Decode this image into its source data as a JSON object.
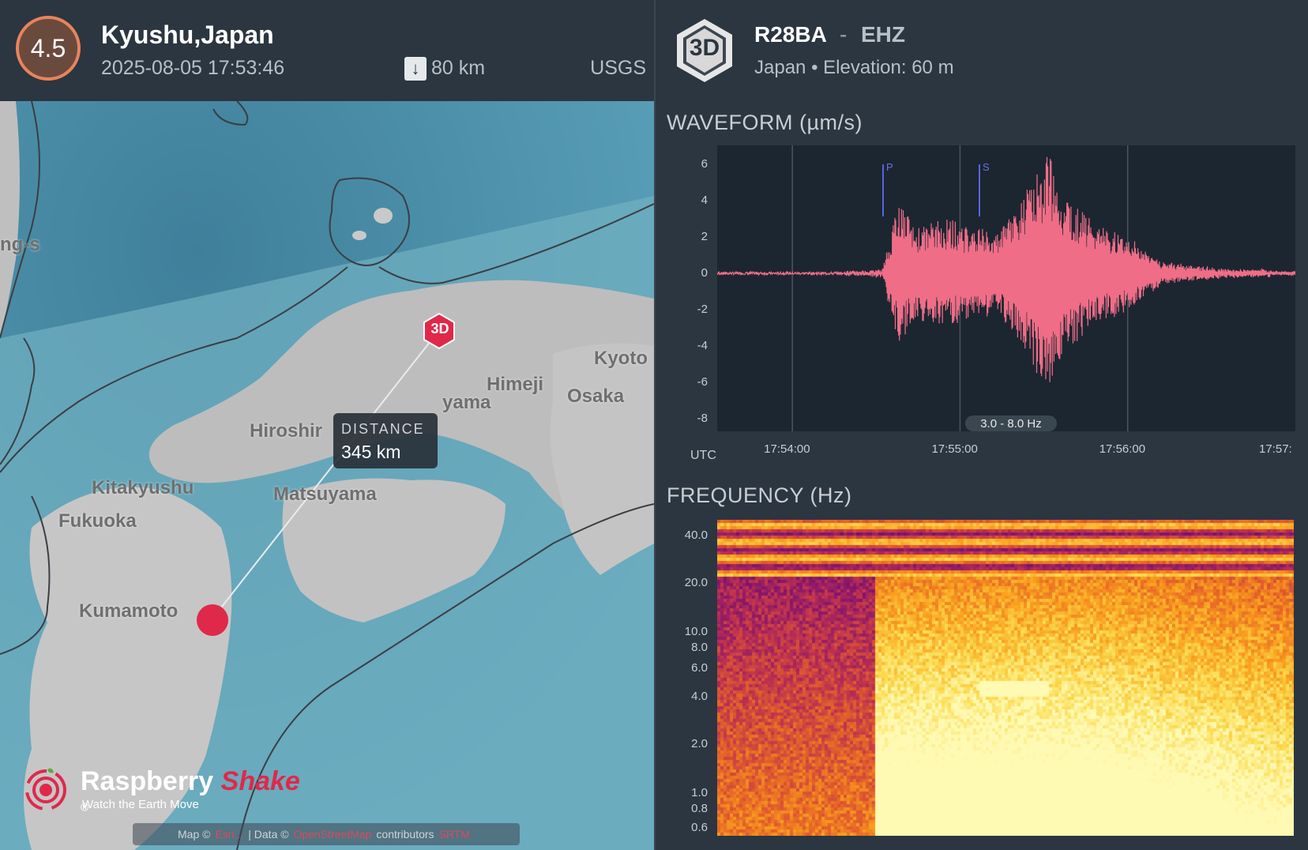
{
  "quake": {
    "magnitude": "4.5",
    "location": "Kyushu,Japan",
    "time": "2025-08-05 17:53:46",
    "depth": "80 km",
    "source": "USGS",
    "depth_icon": "arrow-down-icon"
  },
  "map": {
    "distance_label": "DISTANCE",
    "distance_value": "345 km",
    "station_marker": "3D",
    "cities": [
      "Kyoto",
      "Himeji",
      "Osaka",
      "Hiroshir",
      "yama",
      "Kitakyushu",
      "Fukuoka",
      "Matsuyama",
      "Kumamoto",
      "ng-s"
    ],
    "logo_name": "Raspberry",
    "logo_name_accent": "Shake",
    "logo_mark": "®",
    "logo_tagline": "Watch the Earth Move",
    "attribution_prefix": "Map ©",
    "attribution_link1": "Esri...",
    "attribution_mid": "| Data ©",
    "attribution_link2": "OpenStreetMap",
    "attribution_suffix": "contributors",
    "attribution_link3": "SRTM"
  },
  "station": {
    "badge": "3D",
    "code": "R28BA",
    "separator": "-",
    "channel": "EHZ",
    "country": "Japan",
    "bullet": "•",
    "elevation": "Elevation: 60 m"
  },
  "waveform": {
    "title": "WAVEFORM (µm/s)",
    "y_ticks": [
      "6",
      "4",
      "2",
      "0",
      "-2",
      "-4",
      "-6",
      "-8"
    ],
    "x_ticks": [
      "17:54:00",
      "17:55:00",
      "17:56:00",
      "17:57:"
    ],
    "x_axis_label": "UTC",
    "p_label": "P",
    "s_label": "S",
    "band": "3.0 - 8.0 Hz",
    "line_color": "#f06d87",
    "plot_bg": "#1b2631"
  },
  "frequency": {
    "title": "FREQUENCY (Hz)",
    "y_ticks": [
      "40.0",
      "20.0",
      "10.0",
      "8.0",
      "6.0",
      "4.0",
      "2.0",
      "1.0",
      "0.8",
      "0.6"
    ]
  },
  "chart_data": [
    {
      "type": "line",
      "title": "WAVEFORM (µm/s)",
      "xlabel": "UTC",
      "ylabel": "µm/s",
      "x_ticks": [
        "17:54:00",
        "17:55:00",
        "17:56:00",
        "17:57:"
      ],
      "ylim": [
        -8,
        7
      ],
      "annotations": [
        "P",
        "S",
        "3.0 - 8.0 Hz"
      ],
      "series": [
        {
          "values": [
            0,
            0,
            0,
            0,
            0,
            0,
            0,
            0,
            0.1,
            0.1,
            0.2,
            4.0,
            2.5,
            2.8,
            3.0,
            2.6,
            2.4,
            2.2,
            3.5,
            5.0,
            6.8,
            4.5,
            3.5,
            2.6,
            2.4,
            2.0,
            1.2,
            0.6,
            0.5,
            0.4,
            0.3,
            0.2,
            0.2,
            0.2,
            0.1,
            0.1
          ]
        }
      ]
    },
    {
      "type": "heatmap",
      "title": "FREQUENCY (Hz)",
      "ylabel": "Hz",
      "y_ticks": [
        "40.0",
        "20.0",
        "10.0",
        "8.0",
        "6.0",
        "4.0",
        "2.0",
        "1.0",
        "0.8",
        "0.6"
      ]
    }
  ]
}
